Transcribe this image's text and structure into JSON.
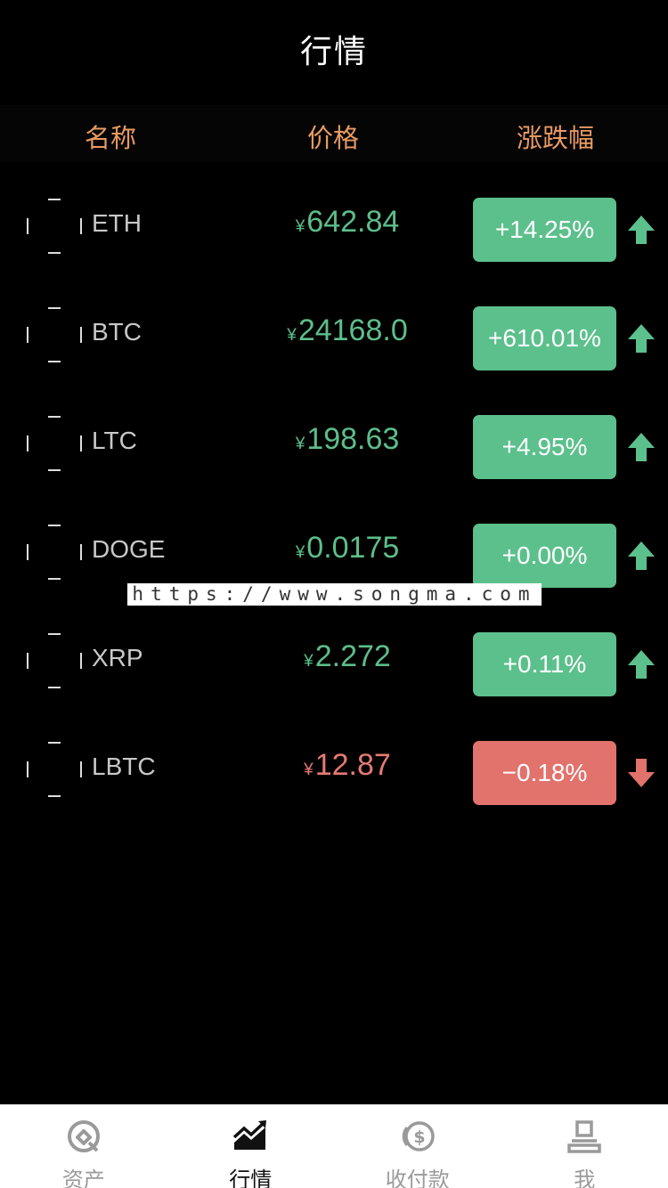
{
  "navbar": {
    "title": "行情"
  },
  "header": {
    "name": "名称",
    "price": "价格",
    "change": "涨跌幅"
  },
  "currency_symbol": "¥",
  "rows": [
    {
      "name": "ETH",
      "price": "642.84",
      "change": "+14.25%",
      "direction": "up"
    },
    {
      "name": "BTC",
      "price": "24168.0",
      "change": "+610.01%",
      "direction": "up"
    },
    {
      "name": "LTC",
      "price": "198.63",
      "change": "+4.95%",
      "direction": "up"
    },
    {
      "name": "DOGE",
      "price": "0.0175",
      "change": "+0.00%",
      "direction": "up"
    },
    {
      "name": "XRP",
      "price": "2.272",
      "change": "+0.11%",
      "direction": "up"
    },
    {
      "name": "LBTC",
      "price": "12.87",
      "change": "−0.18%",
      "direction": "down"
    }
  ],
  "watermark": "https://www.songma.com",
  "colors": {
    "up": "#5cc08c",
    "down": "#e2726c",
    "header": "#e89a63"
  },
  "tabs": [
    {
      "label": "资产",
      "icon": "assets-icon",
      "active": false
    },
    {
      "label": "行情",
      "icon": "market-icon",
      "active": true
    },
    {
      "label": "收付款",
      "icon": "payment-icon",
      "active": false
    },
    {
      "label": "我",
      "icon": "profile-icon",
      "active": false
    }
  ]
}
